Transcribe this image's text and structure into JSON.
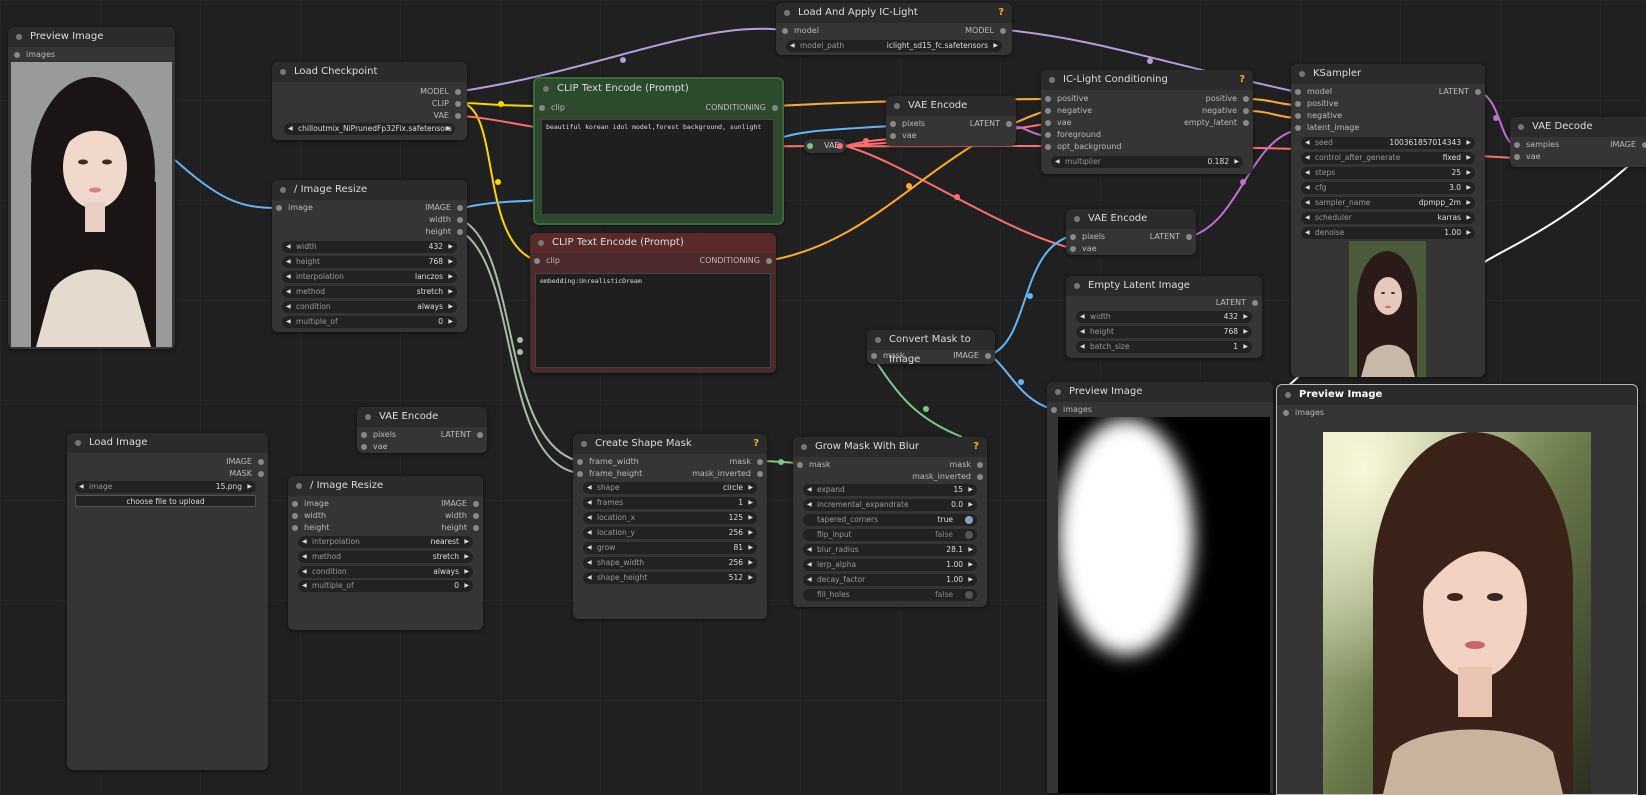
{
  "colors": {
    "latent": "#c070d0",
    "image": "#64b5f6",
    "model": "#b39ddb",
    "clip": "#ffd500",
    "vae": "#ff6e6e",
    "conditioning": "#ffa931",
    "mask": "#81c784",
    "int": "#9ccc65"
  },
  "preview_left": {
    "title": "Preview Image",
    "in": "images"
  },
  "load_checkpoint": {
    "title": "Load Checkpoint",
    "out": [
      "MODEL",
      "CLIP",
      "VAE"
    ],
    "ckpt_name": "chilloutmix_NiPrunedFp32Fix.safetensors"
  },
  "iclight_loader": {
    "title": "Load And Apply IC-Light",
    "help": "?",
    "in": "model",
    "out": "MODEL",
    "model_path_label": "model_path",
    "model_path": "iclight_sd15_fc.safetensors"
  },
  "clip_pos": {
    "title": "CLIP Text Encode (Prompt)",
    "in": "clip",
    "out": "CONDITIONING",
    "text": "beautiful korean idol model,forest background, sunlight"
  },
  "clip_neg": {
    "title": "CLIP Text Encode (Prompt)",
    "in": "clip",
    "out": "CONDITIONING",
    "text": "embedding:UnrealisticDream"
  },
  "image_resize_1": {
    "title": "Image Resize",
    "in": "image",
    "out": [
      "IMAGE",
      "width",
      "height"
    ],
    "widgets": [
      {
        "k": "width",
        "v": "432"
      },
      {
        "k": "height",
        "v": "768"
      },
      {
        "k": "interpolation",
        "v": "lanczos"
      },
      {
        "k": "method",
        "v": "stretch"
      },
      {
        "k": "condition",
        "v": "always"
      },
      {
        "k": "multiple_of",
        "v": "0"
      }
    ]
  },
  "vae_encode_top": {
    "title": "VAE Encode",
    "in": [
      "pixels",
      "vae"
    ],
    "out": "LATENT"
  },
  "vae_reroute": {
    "label": "VAE"
  },
  "iclight_cond": {
    "title": "IC-Light Conditioning",
    "help": "?",
    "in": [
      "positive",
      "negative",
      "vae",
      "foreground",
      "opt_background"
    ],
    "out": [
      "positive",
      "negative",
      "empty_latent"
    ],
    "multiplier_label": "multiplier",
    "multiplier": "0.182"
  },
  "vae_encode_mid": {
    "title": "VAE Encode",
    "in": [
      "pixels",
      "vae"
    ],
    "out": "LATENT"
  },
  "empty_latent": {
    "title": "Empty Latent Image",
    "out": "LATENT",
    "widgets": [
      {
        "k": "width",
        "v": "432"
      },
      {
        "k": "height",
        "v": "768"
      },
      {
        "k": "batch_size",
        "v": "1"
      }
    ]
  },
  "ksampler": {
    "title": "KSampler",
    "in": [
      "model",
      "positive",
      "negative",
      "latent_image"
    ],
    "out": "LATENT",
    "widgets": [
      {
        "k": "seed",
        "v": "1003618570143​43"
      },
      {
        "k": "control_after_generate",
        "v": "fixed"
      },
      {
        "k": "steps",
        "v": "25"
      },
      {
        "k": "cfg",
        "v": "3.0"
      },
      {
        "k": "sampler_name",
        "v": "dpmpp_2m"
      },
      {
        "k": "scheduler",
        "v": "karras"
      },
      {
        "k": "denoise",
        "v": "1.00"
      }
    ]
  },
  "vae_decode": {
    "title": "VAE Decode",
    "in": [
      "samples",
      "vae"
    ],
    "out": "IMAGE"
  },
  "convert_mask": {
    "title": "Convert Mask to Image",
    "in": "mask",
    "out": "IMAGE"
  },
  "preview_mask": {
    "title": "Preview Image",
    "in": "images"
  },
  "preview_final": {
    "title": "Preview Image",
    "in": "images"
  },
  "load_image": {
    "title": "Load Image",
    "out": [
      "IMAGE",
      "MASK"
    ],
    "image_label": "image",
    "image": "15.png",
    "upload": "choose file to upload"
  },
  "vae_encode_low": {
    "title": "VAE Encode",
    "in": [
      "pixels",
      "vae"
    ],
    "out": "LATENT"
  },
  "image_resize_2": {
    "title": "Image Resize",
    "in": [
      "image",
      "width",
      "height"
    ],
    "out": [
      "IMAGE",
      "width",
      "height"
    ],
    "widgets": [
      {
        "k": "interpolation",
        "v": "nearest"
      },
      {
        "k": "method",
        "v": "stretch"
      },
      {
        "k": "condition",
        "v": "always"
      },
      {
        "k": "multiple_of",
        "v": "0"
      }
    ]
  },
  "shape_mask": {
    "title": "Create Shape Mask",
    "help": "?",
    "in": [
      "frame_width",
      "frame_height"
    ],
    "out": [
      "mask",
      "mask_inverted"
    ],
    "widgets": [
      {
        "k": "shape",
        "v": "circle"
      },
      {
        "k": "frames",
        "v": "1"
      },
      {
        "k": "location_x",
        "v": "125"
      },
      {
        "k": "location_y",
        "v": "256"
      },
      {
        "k": "grow",
        "v": "81"
      },
      {
        "k": "shape_width",
        "v": "256"
      },
      {
        "k": "shape_height",
        "v": "512"
      }
    ]
  },
  "grow_mask": {
    "title": "Grow Mask With Blur",
    "help": "?",
    "in": "mask",
    "out": [
      "mask",
      "mask_inverted"
    ],
    "widgets": [
      {
        "k": "expand",
        "v": "15"
      },
      {
        "k": "incremental_expandrate",
        "v": "0.0"
      }
    ],
    "toggles": [
      {
        "k": "tapered_corners",
        "v": "true"
      },
      {
        "k": "flip_input",
        "v": "false"
      }
    ],
    "widgets2": [
      {
        "k": "blur_radius",
        "v": "28.1"
      },
      {
        "k": "lerp_alpha",
        "v": "1.00"
      },
      {
        "k": "decay_factor",
        "v": "1.00"
      }
    ],
    "fill_holes": {
      "k": "fill_holes",
      "v": "false"
    }
  }
}
